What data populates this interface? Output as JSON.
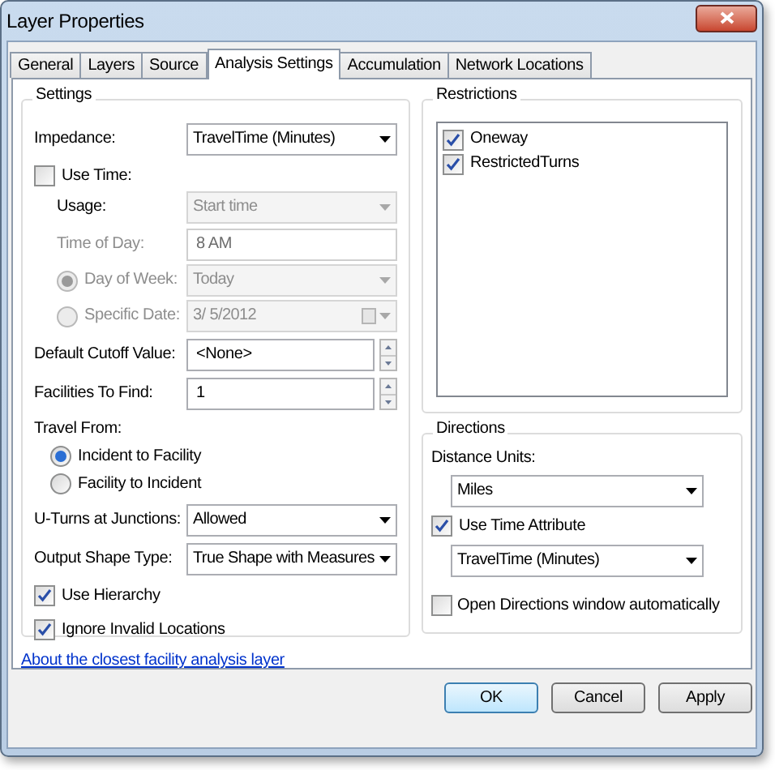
{
  "window": {
    "title": "Layer Properties"
  },
  "tabs": [
    {
      "label": "General",
      "selected": false
    },
    {
      "label": "Layers",
      "selected": false
    },
    {
      "label": "Source",
      "selected": false
    },
    {
      "label": "Analysis Settings",
      "selected": true
    },
    {
      "label": "Accumulation",
      "selected": false
    },
    {
      "label": "Network Locations",
      "selected": false
    }
  ],
  "settings": {
    "title": "Settings",
    "items": [
      {
        "kind": "dropdown",
        "label": "Impedance:",
        "value": "TravelTime (Minutes)",
        "disabled": false,
        "label_disabled": false
      },
      {
        "kind": "checkbox",
        "label": "Use Time:",
        "checked": false,
        "children": [
          {
            "kind": "dropdown",
            "label": "Usage:",
            "value": "Start time",
            "disabled": true,
            "label_disabled": false
          },
          {
            "kind": "field",
            "label": "Time of Day:",
            "value": "8 AM",
            "disabled": true,
            "label_disabled": true
          },
          {
            "kind": "radio-dropdown",
            "label": "Day of Week:",
            "selected": true,
            "value": "Today",
            "disabled": true,
            "label_disabled": true
          },
          {
            "kind": "radio-date",
            "label": "Specific Date:",
            "selected": false,
            "value": "3/ 5/2012",
            "disabled": true,
            "label_disabled": true
          }
        ]
      },
      {
        "kind": "spinner",
        "label": "Default Cutoff Value:",
        "value": "<None>",
        "disabled": false,
        "label_disabled": false
      },
      {
        "kind": "spinner",
        "label": "Facilities To Find:",
        "value": "1",
        "disabled": false,
        "label_disabled": false
      },
      {
        "kind": "radio-group",
        "label": "Travel From:",
        "options": [
          {
            "label": "Incident to Facility",
            "selected": true
          },
          {
            "label": "Facility to Incident",
            "selected": false
          }
        ]
      },
      {
        "kind": "dropdown",
        "label": "U-Turns at Junctions:",
        "value": "Allowed",
        "disabled": false,
        "label_disabled": false
      },
      {
        "kind": "dropdown",
        "label": "Output Shape Type:",
        "value": "True Shape with Measures",
        "disabled": false,
        "label_disabled": false
      },
      {
        "kind": "checkbox",
        "label": "Use Hierarchy",
        "checked": true
      },
      {
        "kind": "checkbox",
        "label": "Ignore Invalid Locations",
        "checked": true
      }
    ]
  },
  "restrictions": {
    "title": "Restrictions",
    "items": [
      {
        "label": "Oneway",
        "checked": true
      },
      {
        "label": "RestrictedTurns",
        "checked": true
      }
    ]
  },
  "directions": {
    "title": "Directions",
    "distance_units_label": "Distance Units:",
    "distance_units": "Miles",
    "use_time_attribute": {
      "label": "Use Time Attribute",
      "checked": true
    },
    "time_attribute": "TravelTime (Minutes)",
    "open_automatically": {
      "label": "Open Directions window automatically",
      "checked": false
    }
  },
  "link": "About the closest facility analysis layer",
  "buttons": [
    {
      "label": "OK",
      "default": true
    },
    {
      "label": "Cancel",
      "default": false
    },
    {
      "label": "Apply",
      "default": false
    }
  ]
}
